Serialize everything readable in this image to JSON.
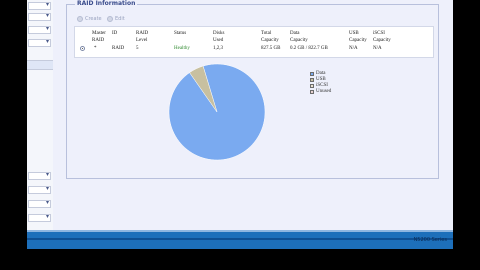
{
  "panel": {
    "title": "RAID Information"
  },
  "toolbar": {
    "create_label": "Create",
    "edit_label": "Edit"
  },
  "table": {
    "columns": [
      "Master RAID",
      "ID",
      "RAID Level",
      "Status",
      "Disks Used",
      "Total Capacity",
      "Data Capacity",
      "USB Capacity",
      "iSCSI Capacity"
    ],
    "row": {
      "master": "*",
      "id": "RAID",
      "level": "5",
      "status": "Healthy",
      "disks": "1,2,3",
      "total": "827.5 GB",
      "data": "0.2 GB / 822.7 GB",
      "usb": "N/A",
      "iscsi": "N/A"
    }
  },
  "legend": [
    {
      "label": "Data",
      "color": "#7aaaf0"
    },
    {
      "label": "USB",
      "color": "#c8c0a0"
    },
    {
      "label": "iSCSI",
      "color": "#e8e0d0"
    },
    {
      "label": "Unused",
      "color": "#e8d2d2"
    }
  ],
  "colors": {
    "data_slice": "#7aaaf0",
    "usb_slice": "#c8c0a0",
    "statusbar": "#1d6fba",
    "healthy": "#2f8a2f"
  },
  "chart_data": {
    "type": "pie",
    "labels": [
      "Data",
      "USB",
      "iSCSI",
      "Unused"
    ],
    "values": [
      95,
      5,
      0,
      0
    ]
  },
  "statusbar": {
    "text": "N5200 Series"
  }
}
